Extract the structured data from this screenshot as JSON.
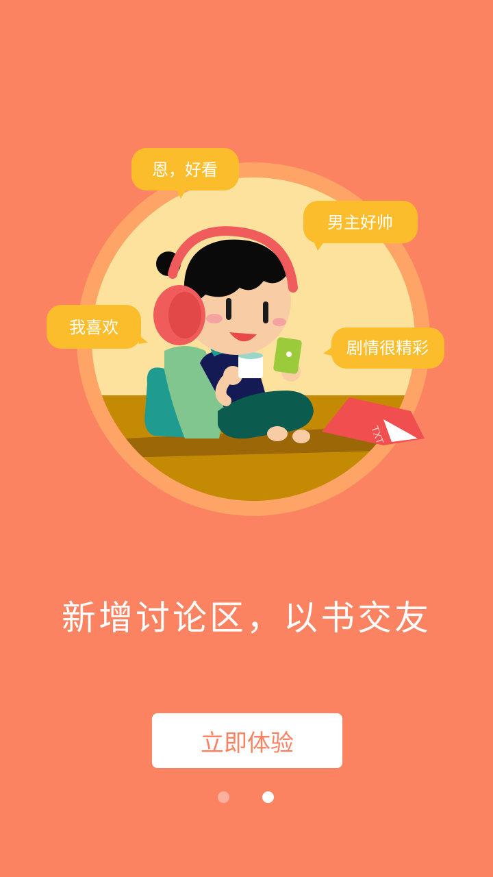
{
  "bubbles": {
    "top": "恩，好看",
    "right_top": "男主好帅",
    "left": "我喜欢",
    "right": "剧情很精彩"
  },
  "book_label": "TXT",
  "headline": "新增讨论区，以书交友",
  "cta_label": "立即体验",
  "pager": {
    "total": 2,
    "active": 2
  },
  "colors": {
    "background": "#FC8362",
    "bubble": "#FBBD2C",
    "button_text": "#FC8362",
    "button_bg": "#FFFFFF"
  }
}
